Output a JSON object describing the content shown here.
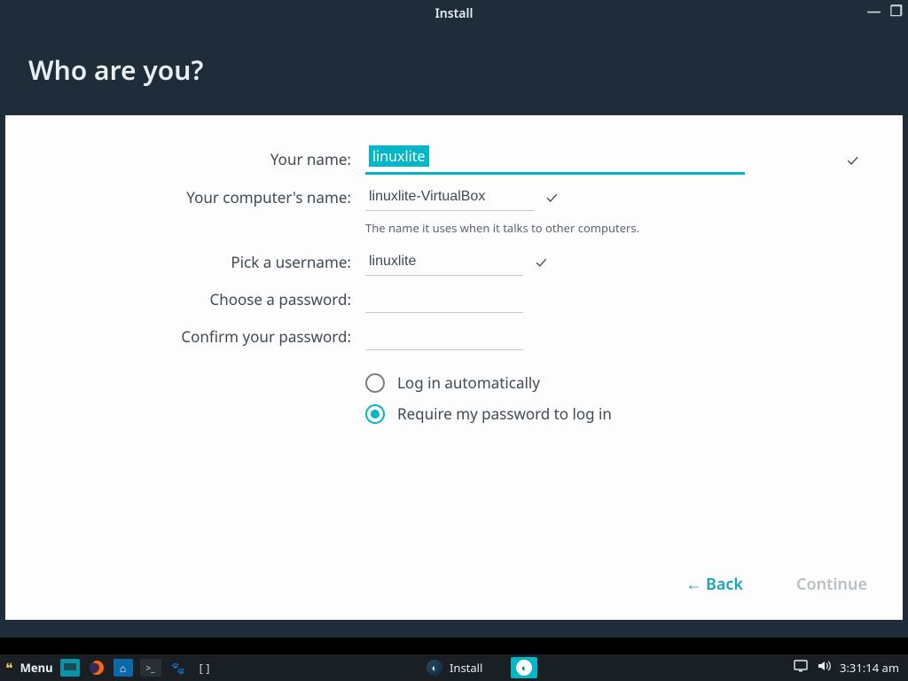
{
  "window": {
    "title": "Install",
    "heading": "Who are you?"
  },
  "form": {
    "name": {
      "label": "Your name:",
      "value": "linuxlite"
    },
    "host": {
      "label": "Your computer's name:",
      "value": "linuxlite-VirtualBox",
      "hint": "The name it uses when it talks to other computers."
    },
    "user": {
      "label": "Pick a username:",
      "value": "linuxlite"
    },
    "pw": {
      "label": "Choose a password:",
      "value": ""
    },
    "pw2": {
      "label": "Confirm your password:",
      "value": ""
    },
    "radios": {
      "auto": "Log in automatically",
      "req": "Require my password to log in",
      "selected": "req"
    }
  },
  "footer": {
    "back": "Back",
    "continue": "Continue"
  },
  "taskbar": {
    "menu": "Menu",
    "app": "Install",
    "time": "3:31:14 am"
  },
  "glyphs": {
    "check": "✓",
    "arrow_left": "←",
    "minimize": "—",
    "maximize": "❐",
    "speaker": "🔊",
    "screen": "▭",
    "home": "⌂",
    "term": ">_",
    "paw": "🐾",
    "brackets": "[ ]"
  }
}
